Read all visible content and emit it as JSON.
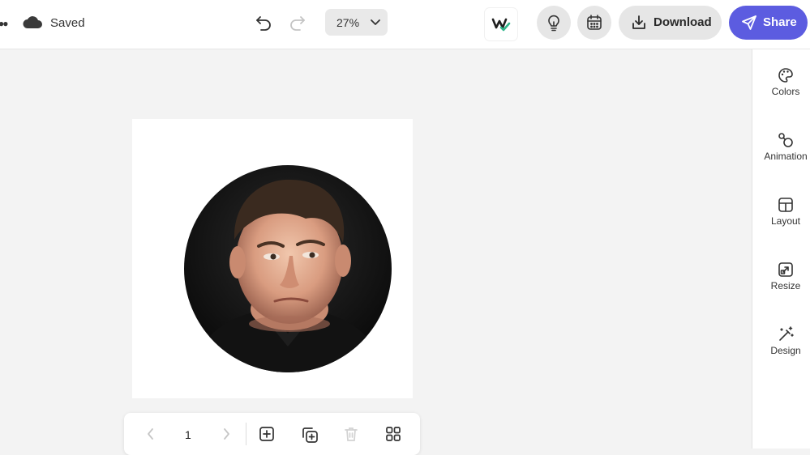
{
  "header": {
    "status_label": "Saved",
    "zoom_value": "27%",
    "download_label": "Download",
    "share_label": "Share",
    "icons": [
      "more-icon",
      "cloud-icon",
      "undo-icon",
      "redo-icon",
      "chevron-down-icon",
      "brand-check-icon",
      "lightbulb-icon",
      "calendar-icon",
      "download-icon",
      "send-icon"
    ]
  },
  "right_panel": {
    "items": [
      {
        "label": "Colors",
        "icon": "palette-icon"
      },
      {
        "label": "Animation",
        "icon": "animation-icon"
      },
      {
        "label": "Layout",
        "icon": "layout-icon"
      },
      {
        "label": "Resize",
        "icon": "resize-icon"
      },
      {
        "label": "Design",
        "icon": "magic-wand-icon"
      }
    ]
  },
  "canvas": {
    "image_description": "circular portrait photo"
  },
  "page_bar": {
    "current_page": "1",
    "icons": [
      "chevron-left-icon",
      "chevron-right-icon",
      "add-page-icon",
      "duplicate-page-icon",
      "delete-page-icon",
      "grid-view-icon"
    ]
  },
  "colors": {
    "accent": "#5c5ce0",
    "button_gray": "#e6e6e6",
    "canvas_bg": "#f3f3f3",
    "brand_check": "#2fb58a"
  }
}
